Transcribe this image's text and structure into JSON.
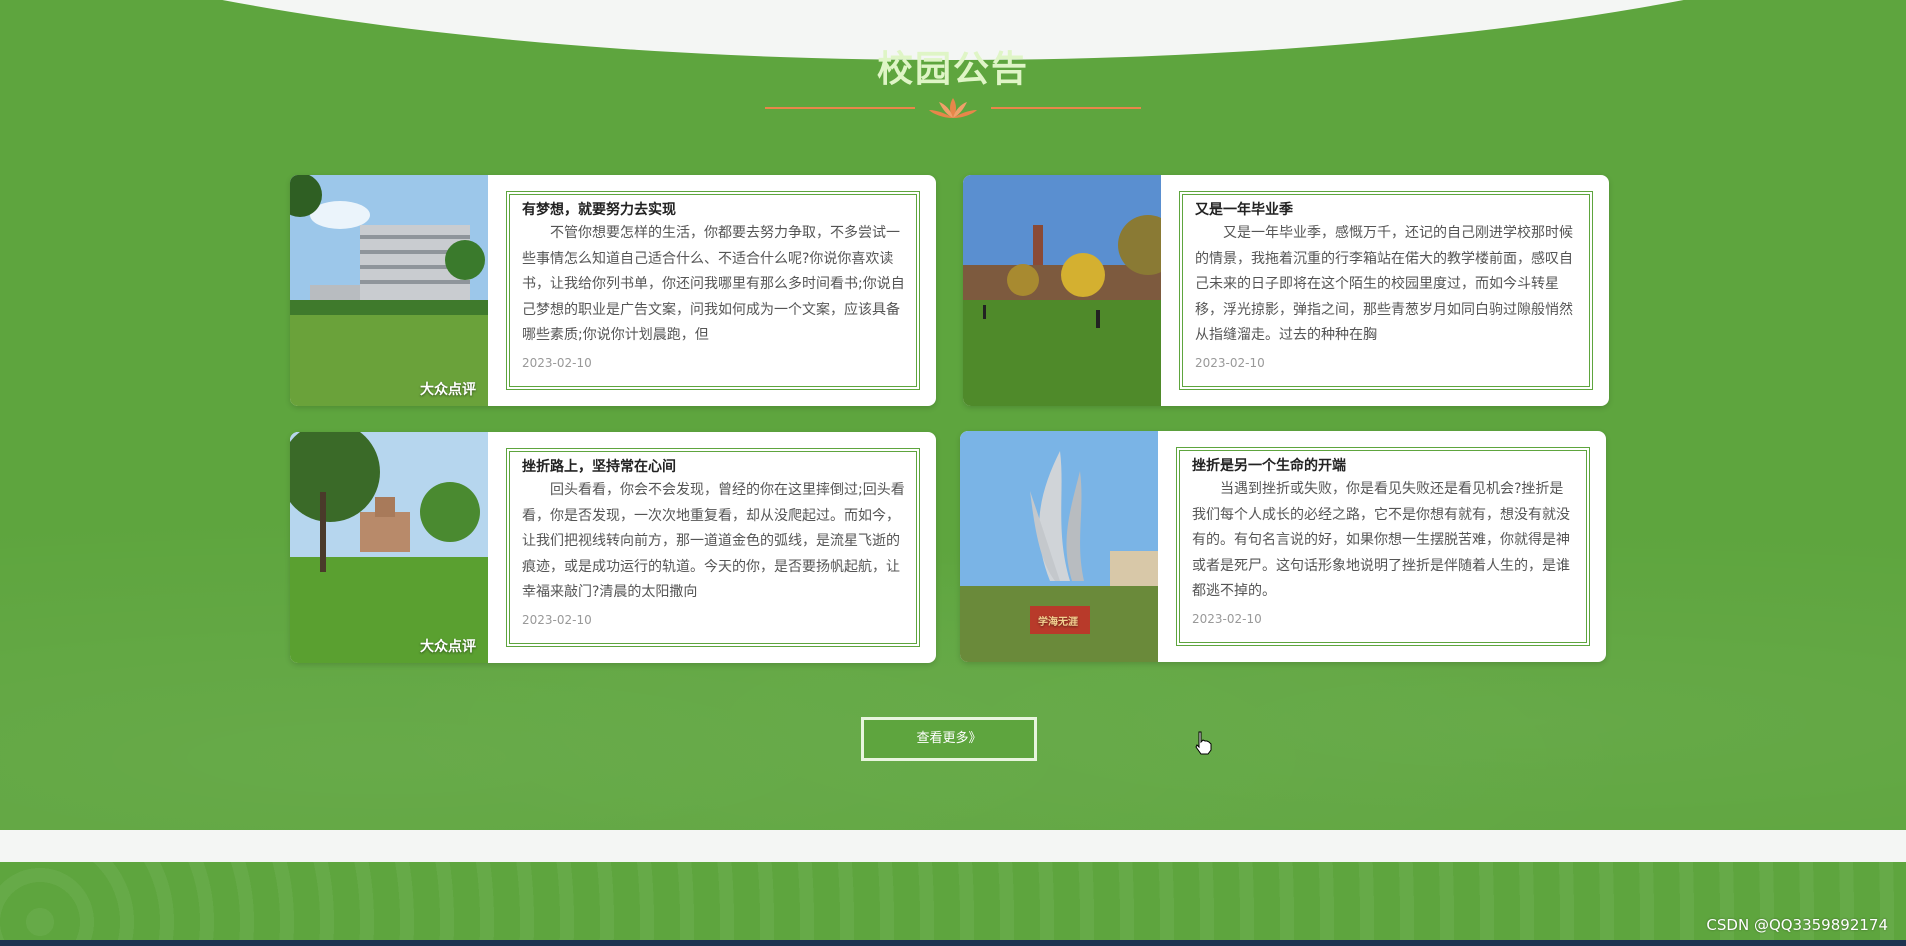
{
  "section": {
    "title": "校园公告"
  },
  "notices": [
    {
      "title": "有梦想，就要努力去实现",
      "text": "不管你想要怎样的生活，你都要去努力争取，不多尝试一些事情怎么知道自己适合什么、不适合什么呢?你说你喜欢读书，让我给你列书单，你还问我哪里有那么多时间看书;你说自己梦想的职业是广告文案，问我如何成为一个文案，应该具备哪些素质;你说你计划晨跑，但",
      "date": "2023-02-10",
      "image_watermark": "大众点评"
    },
    {
      "title": "又是一年毕业季",
      "text": "又是一年毕业季，感慨万千，还记的自己刚进学校那时候的情景，我拖着沉重的行李箱站在偌大的教学楼前面，感叹自己未来的日子即将在这个陌生的校园里度过，而如今斗转星移，浮光掠影，弹指之间，那些青葱岁月如同白驹过隙般悄然从指缝溜走。过去的种种在胸",
      "date": "2023-02-10"
    },
    {
      "title": "挫折路上，坚持常在心间",
      "text": "回头看看，你会不会发现，曾经的你在这里摔倒过;回头看看，你是否发现，一次次地重复看，却从没爬起过。而如今，让我们把视线转向前方，那一道道金色的弧线，是流星飞逝的痕迹，或是成功运行的轨道。今天的你，是否要扬帆起航，让幸福来敲门?清晨的太阳撒向",
      "date": "2023-02-10",
      "image_watermark": "大众点评"
    },
    {
      "title": "挫折是另一个生命的开端",
      "text": "当遇到挫折或失败，你是看见失败还是看见机会?挫折是我们每个人成长的必经之路，它不是你想有就有，想没有就没有的。有句名言说的好，如果你想一生摆脱苦难，你就得是神或者是死尸。这句话形象地说明了挫折是伴随着人生的，是谁都逃不掉的。",
      "date": "2023-02-10",
      "sculpture_plaque": "学海无涯"
    }
  ],
  "more_button": {
    "label": "查看更多》"
  },
  "watermark": "CSDN @QQ3359892174",
  "colors": {
    "primary_green": "#5ea53e",
    "accent_orange": "#e8864a",
    "title_green": "#dff5c6"
  }
}
